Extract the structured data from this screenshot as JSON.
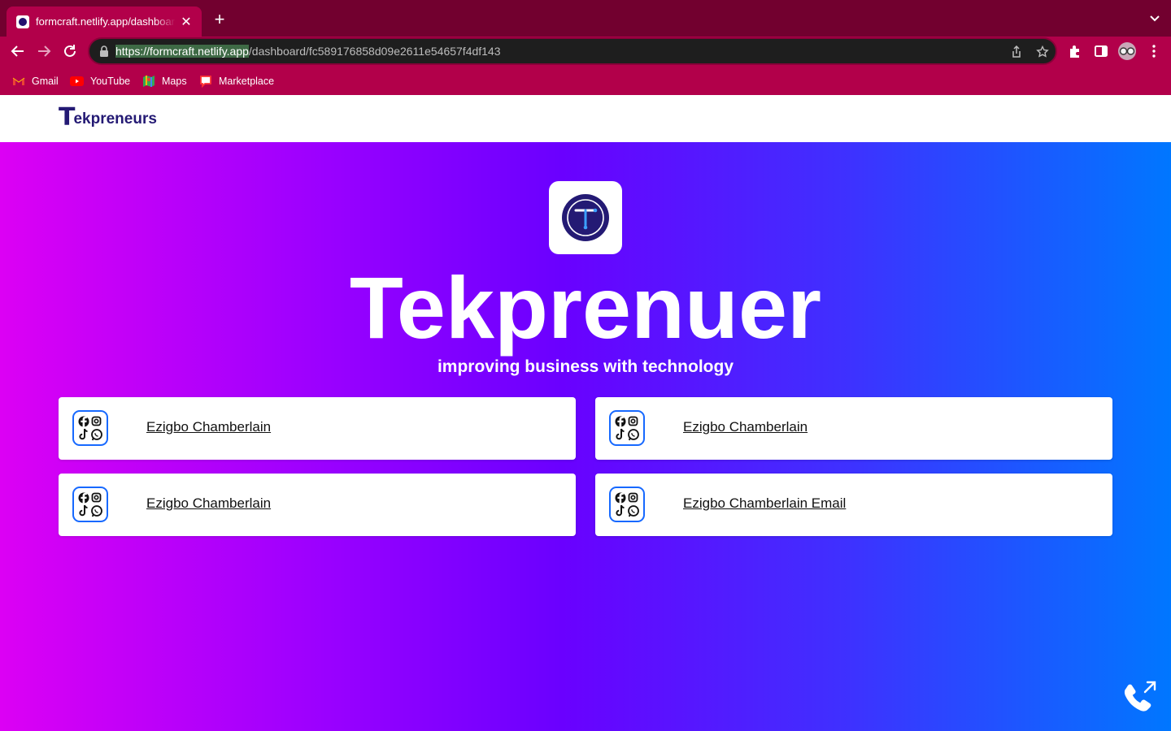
{
  "browser": {
    "tab": {
      "title": "formcraft.netlify.app/dashboard"
    },
    "address": {
      "url_selected": "https://formcraft.netlify.app",
      "url_rest": "/dashboard/fc589176858d09e2611e54657f4df143"
    },
    "bookmarks": [
      {
        "label": "Gmail",
        "icon": "gmail-icon"
      },
      {
        "label": "YouTube",
        "icon": "youtube-icon"
      },
      {
        "label": "Maps",
        "icon": "maps-icon"
      },
      {
        "label": "Marketplace",
        "icon": "marketplace-icon"
      }
    ]
  },
  "site": {
    "logo": {
      "initial": "T",
      "rest": "ekpreneurs"
    },
    "hero": {
      "title": "Tekprenuer",
      "subtitle": "improving business with technology"
    },
    "links": [
      {
        "label": "Ezigbo Chamberlain",
        "icon": "social-apps-icon"
      },
      {
        "label": "Ezigbo Chamberlain",
        "icon": "social-apps-icon"
      },
      {
        "label": "Ezigbo Chamberlain",
        "icon": "social-apps-icon"
      },
      {
        "label": "Ezigbo Chamberlain Email",
        "icon": "social-apps-icon"
      }
    ],
    "fab": {
      "icon": "outgoing-call-icon"
    }
  },
  "colors": {
    "tabstrip": "#72002f",
    "toolbar": "#b2004a",
    "brand_navy": "#241a74",
    "card_border": "#1769ff",
    "gradient_start": "#dc00f4",
    "gradient_end": "#0077ff"
  }
}
